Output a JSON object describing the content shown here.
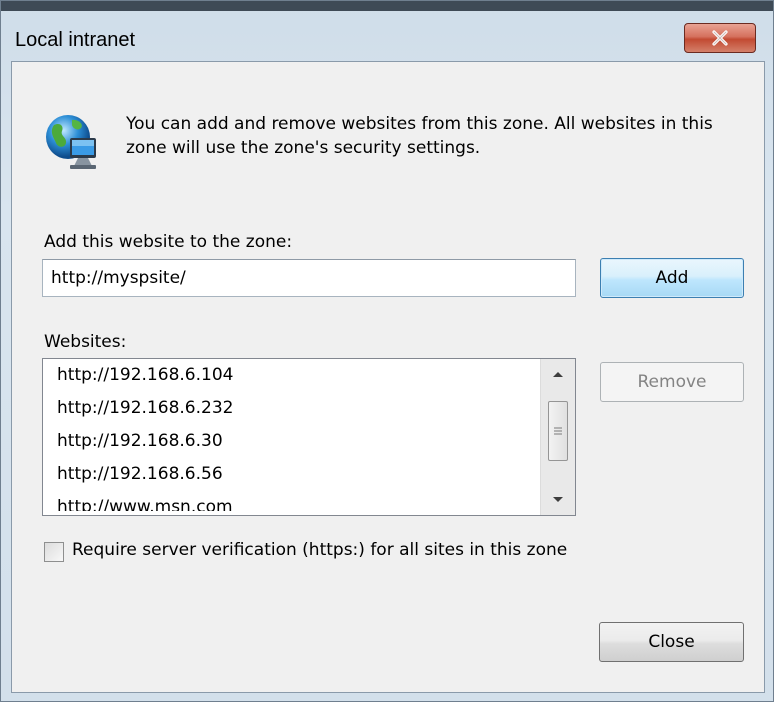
{
  "window": {
    "title": "Local intranet",
    "close_label": "x"
  },
  "info": {
    "icon": "globe-computer-icon",
    "text": "You can add and remove websites from this zone. All websites in this zone will use the zone's security settings."
  },
  "add_zone": {
    "label": "Add this website to the zone:",
    "value": "http://myspsite/",
    "button": "Add"
  },
  "websites": {
    "label": "Websites:",
    "items": [
      "http://192.168.6.104",
      "http://192.168.6.232",
      "http://192.168.6.30",
      "http://192.168.6.56",
      "http://www.msn.com"
    ],
    "remove_button": "Remove"
  },
  "require_verification": {
    "label": "Require server verification (https:) for all sites in this zone",
    "checked": false
  },
  "footer": {
    "close_button": "Close"
  }
}
